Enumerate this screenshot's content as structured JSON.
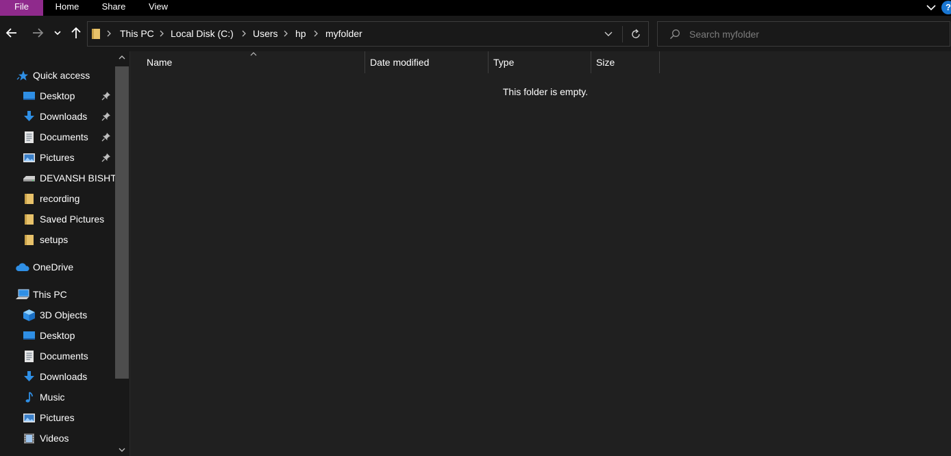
{
  "ribbon": {
    "tabs": [
      "File",
      "Home",
      "Share",
      "View"
    ],
    "help_label": "?"
  },
  "address": {
    "crumbs": [
      "This PC",
      "Local Disk (C:)",
      "Users",
      "hp",
      "myfolder"
    ]
  },
  "search": {
    "placeholder": "Search myfolder"
  },
  "sidebar": {
    "quick_access": "Quick access",
    "quick_items": [
      "Desktop",
      "Downloads",
      "Documents",
      "Pictures",
      "DEVANSH BISHT",
      "recording",
      "Saved Pictures",
      "setups"
    ],
    "onedrive": "OneDrive",
    "this_pc": "This PC",
    "pc_items": [
      "3D Objects",
      "Desktop",
      "Documents",
      "Downloads",
      "Music",
      "Pictures",
      "Videos"
    ]
  },
  "columns": [
    "Name",
    "Date modified",
    "Type",
    "Size"
  ],
  "empty_message": "This folder is empty.",
  "colors": {
    "file_tab": "#8f2a8c",
    "accent": "#1976d2",
    "folder": "#e8c26a"
  }
}
